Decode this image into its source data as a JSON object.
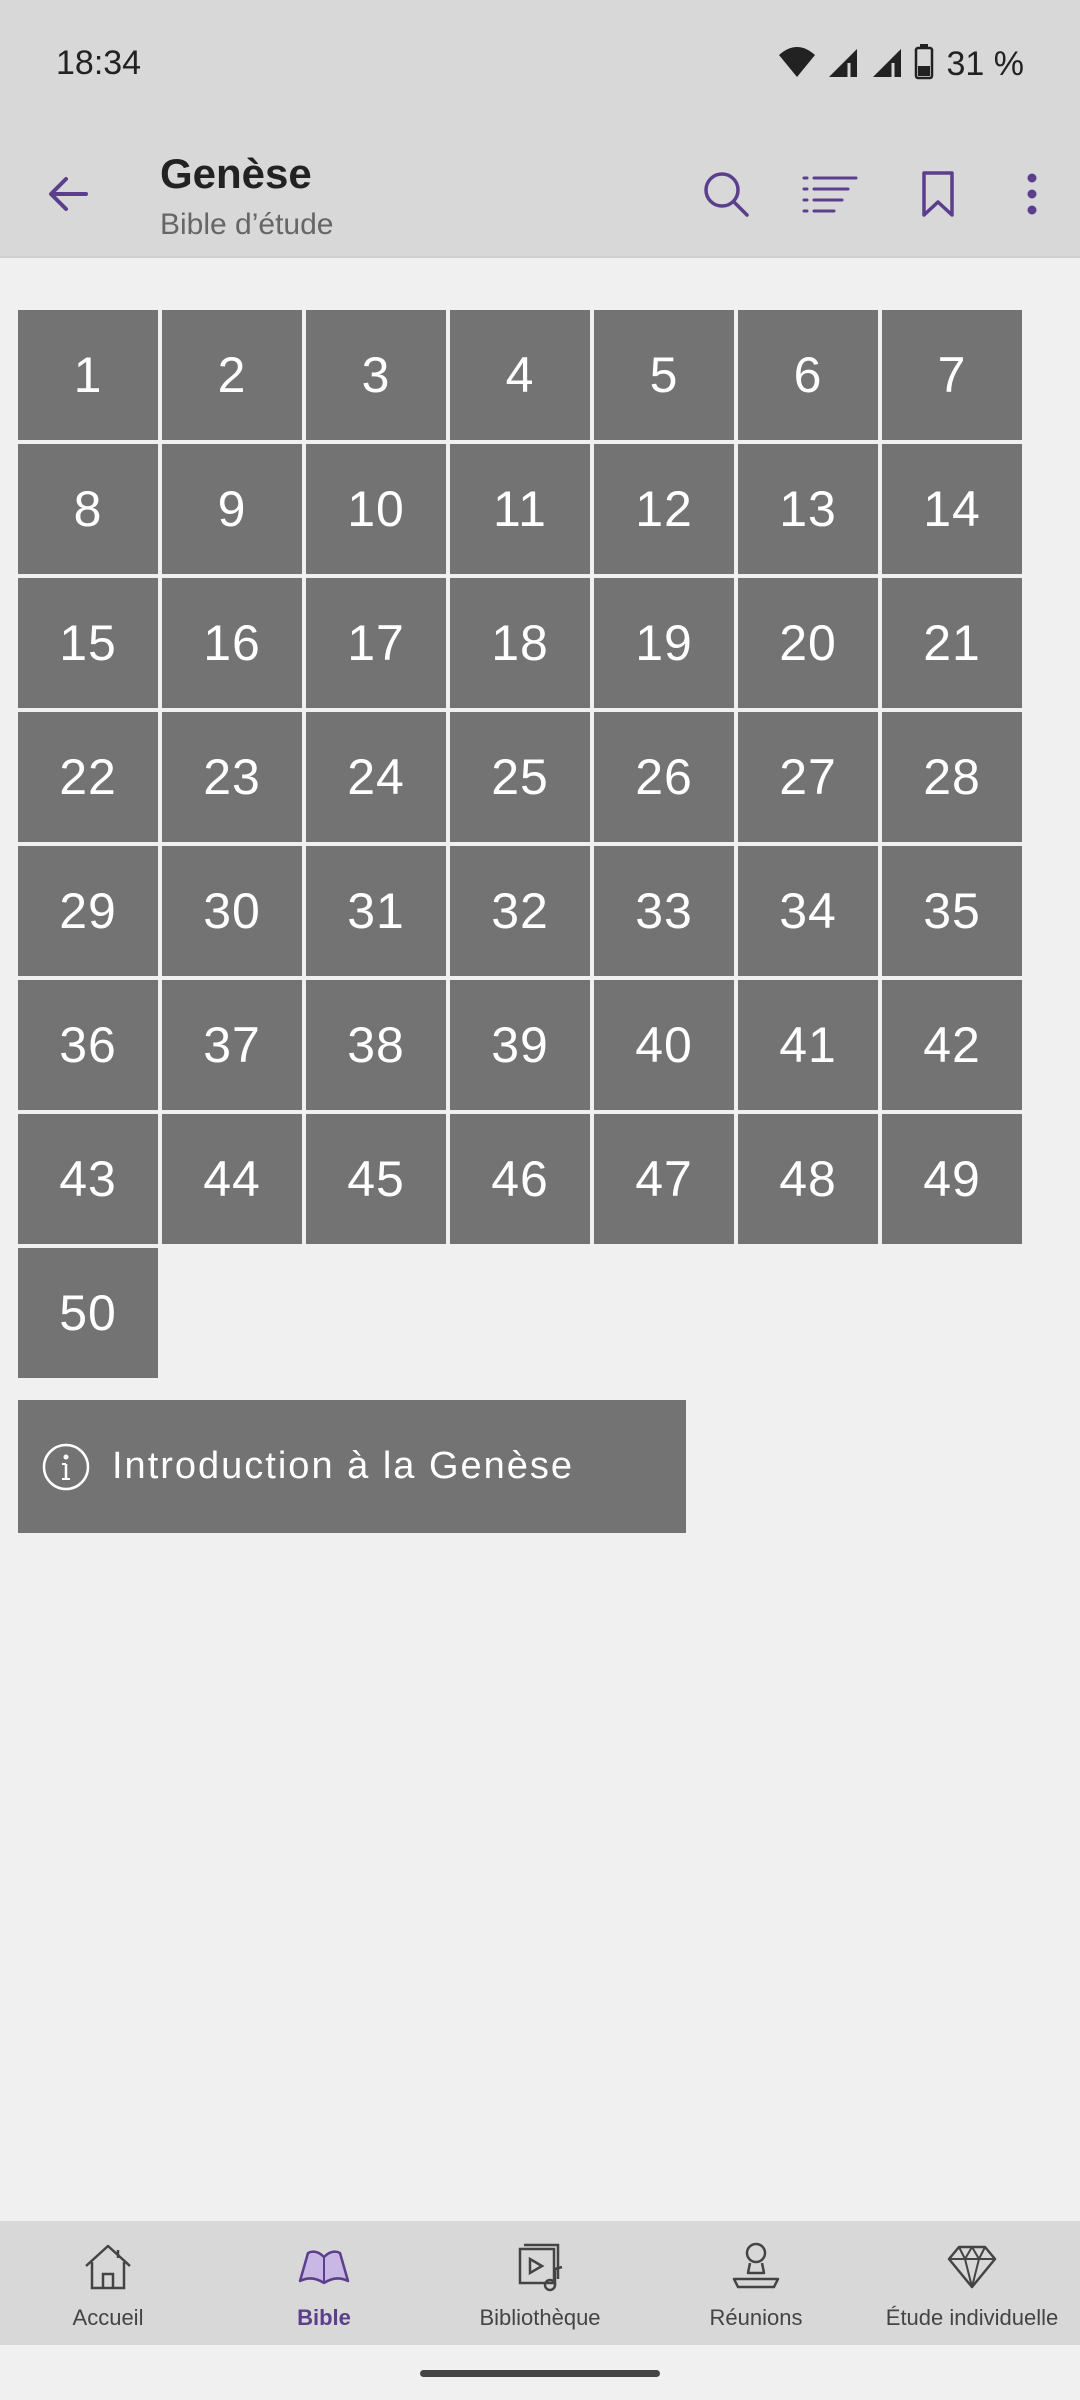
{
  "status": {
    "time": "18:34",
    "battery": "31 %"
  },
  "header": {
    "title": "Genèse",
    "subtitle": "Bible d’étude"
  },
  "chapters": [
    "1",
    "2",
    "3",
    "4",
    "5",
    "6",
    "7",
    "8",
    "9",
    "10",
    "11",
    "12",
    "13",
    "14",
    "15",
    "16",
    "17",
    "18",
    "19",
    "20",
    "21",
    "22",
    "23",
    "24",
    "25",
    "26",
    "27",
    "28",
    "29",
    "30",
    "31",
    "32",
    "33",
    "34",
    "35",
    "36",
    "37",
    "38",
    "39",
    "40",
    "41",
    "42",
    "43",
    "44",
    "45",
    "46",
    "47",
    "48",
    "49",
    "50"
  ],
  "intro": {
    "label": "Introduction à la Genèse",
    "icon": "info-icon"
  },
  "nav": [
    {
      "label": "Accueil",
      "icon": "home-icon",
      "active": false
    },
    {
      "label": "Bible",
      "icon": "bible-icon",
      "active": true
    },
    {
      "label": "Bibliothèque",
      "icon": "library-icon",
      "active": false
    },
    {
      "label": "Réunions",
      "icon": "meetings-icon",
      "active": false
    },
    {
      "label": "Étude individuelle",
      "icon": "study-icon",
      "active": false
    }
  ],
  "colors": {
    "accent": "#5b3f8c",
    "tile": "#737373",
    "bar": "#d8d8d8",
    "background": "#f0f0f0"
  }
}
